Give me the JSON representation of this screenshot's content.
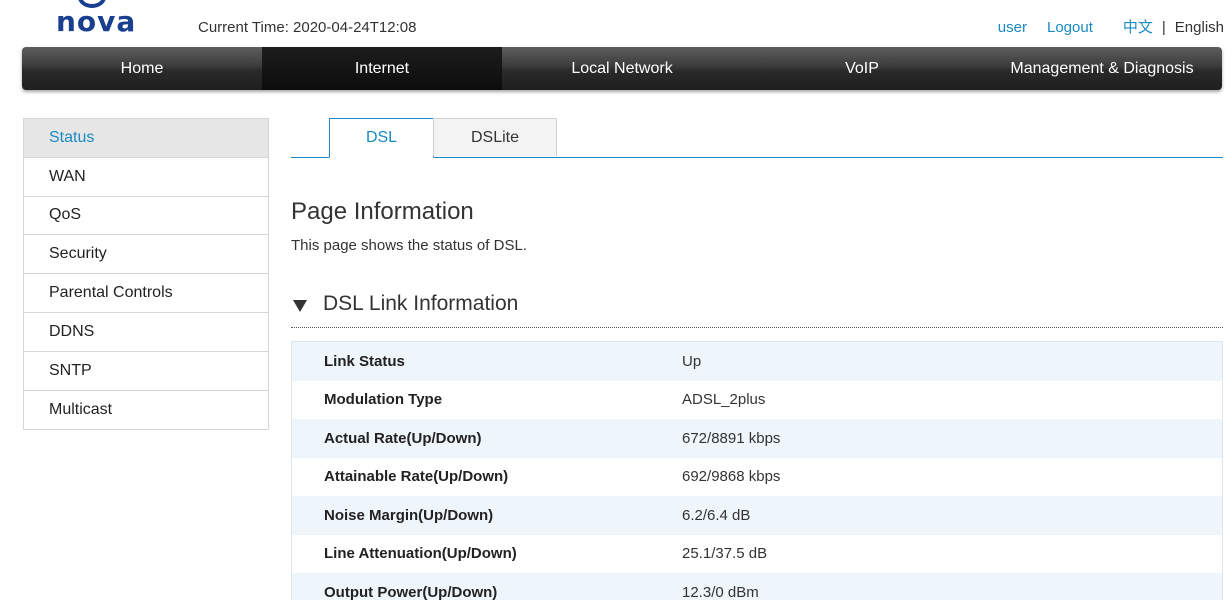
{
  "header": {
    "logo_text": "nova",
    "current_time": "Current Time: 2020-04-24T12:08",
    "user_label": "user",
    "logout_label": "Logout",
    "lang_zh": "中文",
    "lang_sep": "|",
    "lang_en": "English"
  },
  "nav": {
    "items": [
      {
        "label": "Home"
      },
      {
        "label": "Internet"
      },
      {
        "label": "Local Network"
      },
      {
        "label": "VoIP"
      },
      {
        "label": "Management & Diagnosis"
      }
    ],
    "active": "Internet"
  },
  "sidebar": {
    "items": [
      {
        "label": "Status"
      },
      {
        "label": "WAN"
      },
      {
        "label": "QoS"
      },
      {
        "label": "Security"
      },
      {
        "label": "Parental Controls"
      },
      {
        "label": "DDNS"
      },
      {
        "label": "SNTP"
      },
      {
        "label": "Multicast"
      }
    ],
    "active": "Status"
  },
  "tabs": {
    "items": [
      {
        "label": "DSL"
      },
      {
        "label": "DSLite"
      }
    ],
    "active": "DSL"
  },
  "page": {
    "title": "Page Information",
    "description": "This page shows the status of DSL."
  },
  "section": {
    "title": "DSL Link Information",
    "rows": [
      {
        "label": "Link Status",
        "value": "Up"
      },
      {
        "label": "Modulation Type",
        "value": "ADSL_2plus"
      },
      {
        "label": "Actual Rate(Up/Down)",
        "value": "672/8891 kbps"
      },
      {
        "label": "Attainable Rate(Up/Down)",
        "value": "692/9868 kbps"
      },
      {
        "label": "Noise Margin(Up/Down)",
        "value": "6.2/6.4 dB"
      },
      {
        "label": "Line Attenuation(Up/Down)",
        "value": "25.1/37.5 dB"
      },
      {
        "label": "Output Power(Up/Down)",
        "value": "12.3/0 dBm"
      }
    ]
  },
  "colors": {
    "accent": "#1a8ac2",
    "brand": "#1a3f8f",
    "row_alt": "#eef5fb"
  }
}
